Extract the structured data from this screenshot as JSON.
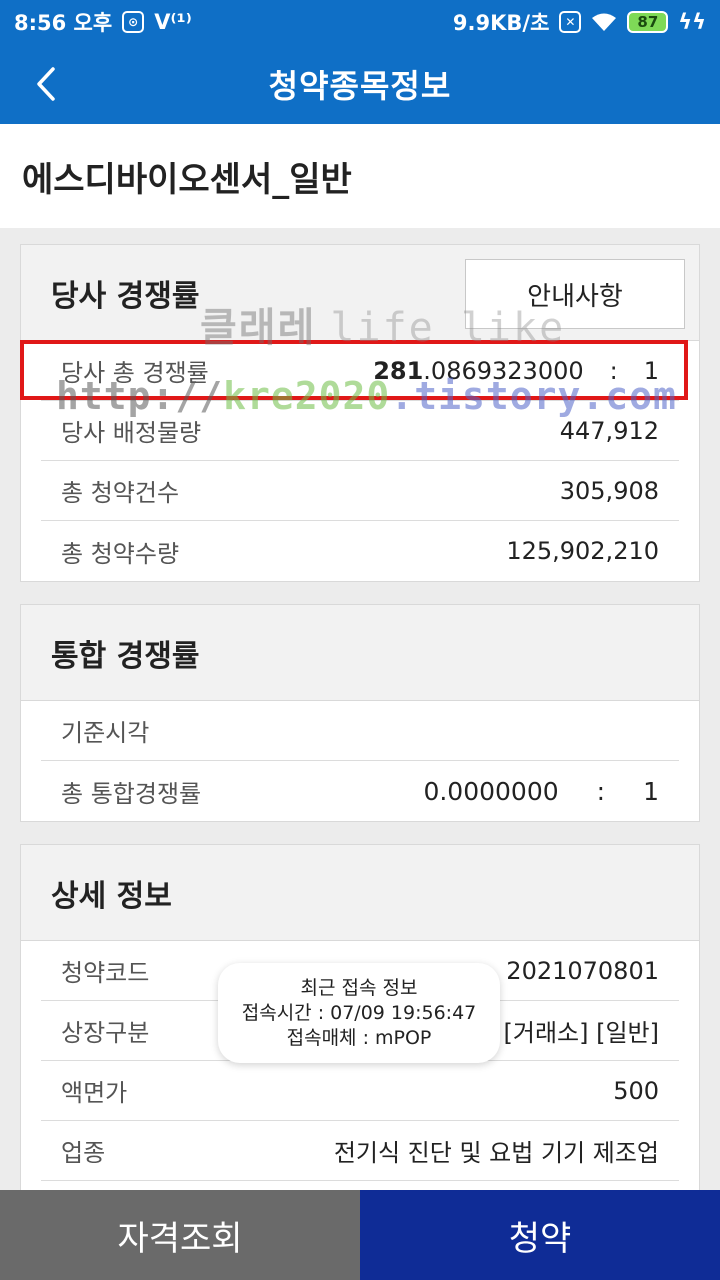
{
  "status_bar": {
    "time": "8:56 오후",
    "speed": "9.9KB/초",
    "battery": "87",
    "icon_names": [
      "app-icon",
      "v-icon",
      "sim-x-icon",
      "wifi-icon",
      "battery-icon",
      "charging-icon"
    ]
  },
  "header": {
    "title": "청약종목정보",
    "back_icon": "chevron-left-icon",
    "color": "#0f6fc6"
  },
  "stock": {
    "name": "에스디바이오센서_일반"
  },
  "company_competition": {
    "title": "당사 경쟁률",
    "notice_label": "안내사항",
    "total_rate_label": "당사 총 경쟁률",
    "total_rate_int": "281",
    "total_rate_frac": ".0869323000",
    "separator": ":",
    "total_rate_ratio": "1",
    "allocation_label": "당사 배정물량",
    "allocation_value": "447,912",
    "applications_label": "총 청약건수",
    "applications_value": "305,908",
    "quantity_label": "총 청약수량",
    "quantity_value": "125,902,210"
  },
  "integrated_competition": {
    "title": "통합 경쟁률",
    "base_time_label": "기준시각",
    "base_time_value": "",
    "total_label": "총 통합경쟁률",
    "total_value": "0.0000000",
    "separator": ":",
    "total_ratio": "1"
  },
  "details": {
    "title": "상세 정보",
    "rows": [
      {
        "label": "청약코드",
        "value": "2021070801"
      },
      {
        "label": "상장구분",
        "value": "[거래소] [일반]"
      },
      {
        "label": "액면가",
        "value": "500"
      },
      {
        "label": "업종",
        "value": "전기식 진단 및 요법 기기 제조업"
      }
    ]
  },
  "toast": {
    "line1": "최근 접속 정보",
    "line2": "접속시간 : 07/09 19:56:47",
    "line3": "접속매체 : mPOP"
  },
  "watermark": {
    "name": "클래레",
    "tagline": "life like",
    "url_prefix": "http://",
    "url_mid": "kre2020",
    "url_suffix": ".tistory.com"
  },
  "bottom": {
    "qualification_label": "자격조회",
    "subscribe_label": "청약",
    "qualification_color": "#6a6a6a",
    "subscribe_color": "#0f2c96"
  },
  "accent_colors": {
    "highlight": "#e01818"
  }
}
